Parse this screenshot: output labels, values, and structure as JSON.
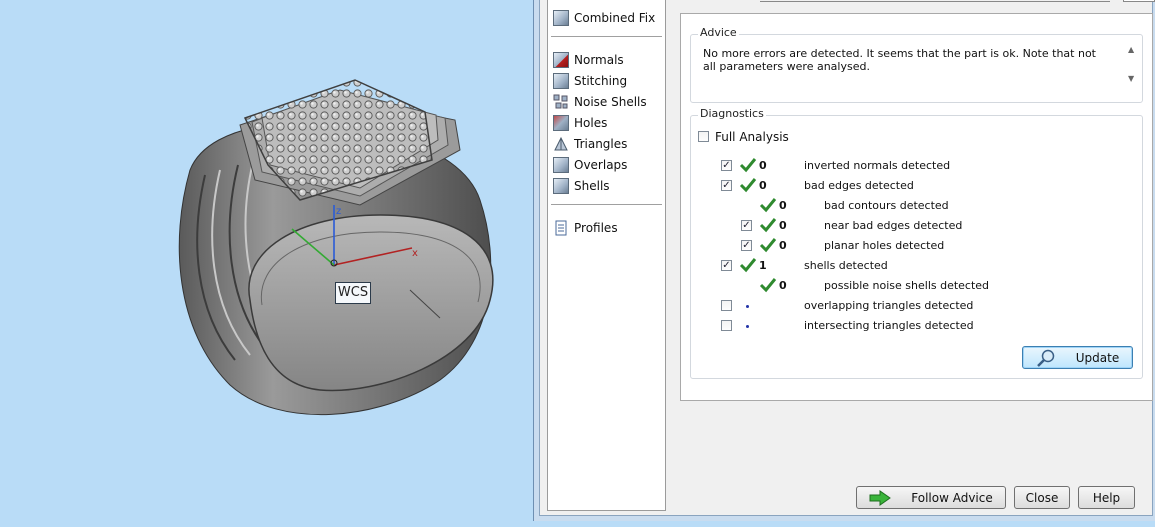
{
  "viewport": {
    "axis_labels": {
      "z": "z",
      "x": "x"
    },
    "wcs_label": "WCS"
  },
  "nav": {
    "items": [
      {
        "label": "Combined Fix",
        "icon": "combined-fix-icon"
      },
      {
        "label": "Normals",
        "icon": "normals-icon"
      },
      {
        "label": "Stitching",
        "icon": "stitching-icon"
      },
      {
        "label": "Noise Shells",
        "icon": "noise-shells-icon"
      },
      {
        "label": "Holes",
        "icon": "holes-icon"
      },
      {
        "label": "Triangles",
        "icon": "triangles-icon"
      },
      {
        "label": "Overlaps",
        "icon": "overlaps-icon"
      },
      {
        "label": "Shells",
        "icon": "shells-icon"
      },
      {
        "label": "Profiles",
        "icon": "profiles-icon"
      }
    ]
  },
  "advice": {
    "title": "Advice",
    "text": "No more errors are detected. It seems that the part is ok. Note that not all parameters were analysed."
  },
  "diagnostics": {
    "title": "Diagnostics",
    "full_analysis_label": "Full Analysis",
    "rows": [
      {
        "checked": true,
        "status": "ok",
        "count": "0",
        "label": "inverted normals detected"
      },
      {
        "checked": true,
        "status": "ok",
        "count": "0",
        "label": "bad edges detected"
      },
      {
        "checked": null,
        "status": "ok",
        "count": "0",
        "label": "bad contours detected"
      },
      {
        "checked": true,
        "status": "ok",
        "count": "0",
        "label": "near bad edges detected"
      },
      {
        "checked": true,
        "status": "ok",
        "count": "0",
        "label": "planar holes detected"
      },
      {
        "checked": true,
        "status": "ok",
        "count": "1",
        "label": "shells detected"
      },
      {
        "checked": null,
        "status": "ok",
        "count": "0",
        "label": "possible noise shells detected"
      },
      {
        "checked": false,
        "status": "none",
        "count": "",
        "label": "overlapping triangles detected"
      },
      {
        "checked": false,
        "status": "none",
        "count": "",
        "label": "intersecting triangles detected"
      }
    ],
    "update_label": "Update"
  },
  "footer": {
    "follow_advice_label": "Follow Advice",
    "close_label": "Close",
    "help_label": "Help"
  },
  "colors": {
    "viewport_bg": "#b9dcf7",
    "check_green": "#2f8a2f",
    "axis_x": "#b22222",
    "axis_y": "#33aa33",
    "axis_z": "#2a5bd7"
  }
}
